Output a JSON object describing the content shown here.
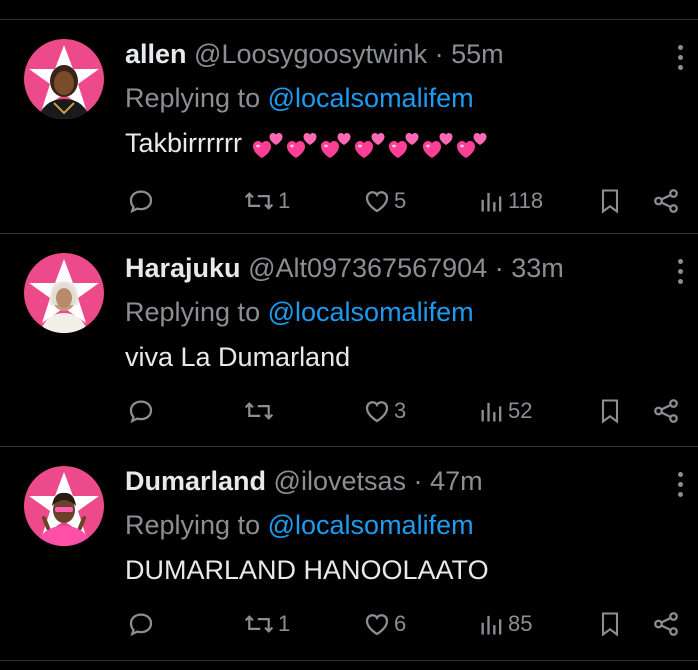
{
  "tweets": [
    {
      "name": "allen",
      "handle": "@Loosygoosytwink",
      "separator": "·",
      "time": "55m",
      "replying_prefix": "Replying to",
      "replying_to": "@localsomalifem",
      "text": "Takbirrrrrr",
      "emoji_count_shown": 7,
      "emoji": "two-hearts-emoji",
      "replies": "",
      "retweets": "1",
      "likes": "5",
      "views": "118"
    },
    {
      "name": "Harajuku",
      "handle": "@Alt097367567904",
      "separator": "·",
      "time": "33m",
      "replying_prefix": "Replying to",
      "replying_to": "@localsomalifem",
      "text": "viva La Dumarland",
      "replies": "",
      "retweets": "",
      "likes": "3",
      "views": "52"
    },
    {
      "name": "Dumarland",
      "handle": "@ilovetsas",
      "separator": "·",
      "time": "47m",
      "replying_prefix": "Replying to",
      "replying_to": "@localsomalifem",
      "text": "DUMARLAND HANOOLAATO",
      "replies": "",
      "retweets": "1",
      "likes": "6",
      "views": "85"
    }
  ],
  "colors": {
    "background": "#000000",
    "text_primary": "#e7e9ea",
    "text_secondary": "#8b8f93",
    "link": "#1d9bf0",
    "avatar_bg": "#ec4a8a",
    "divider": "#2f3336"
  },
  "icons": [
    "reply-icon",
    "retweet-icon",
    "like-icon",
    "views-icon",
    "bookmark-icon",
    "share-icon",
    "more-icon"
  ]
}
